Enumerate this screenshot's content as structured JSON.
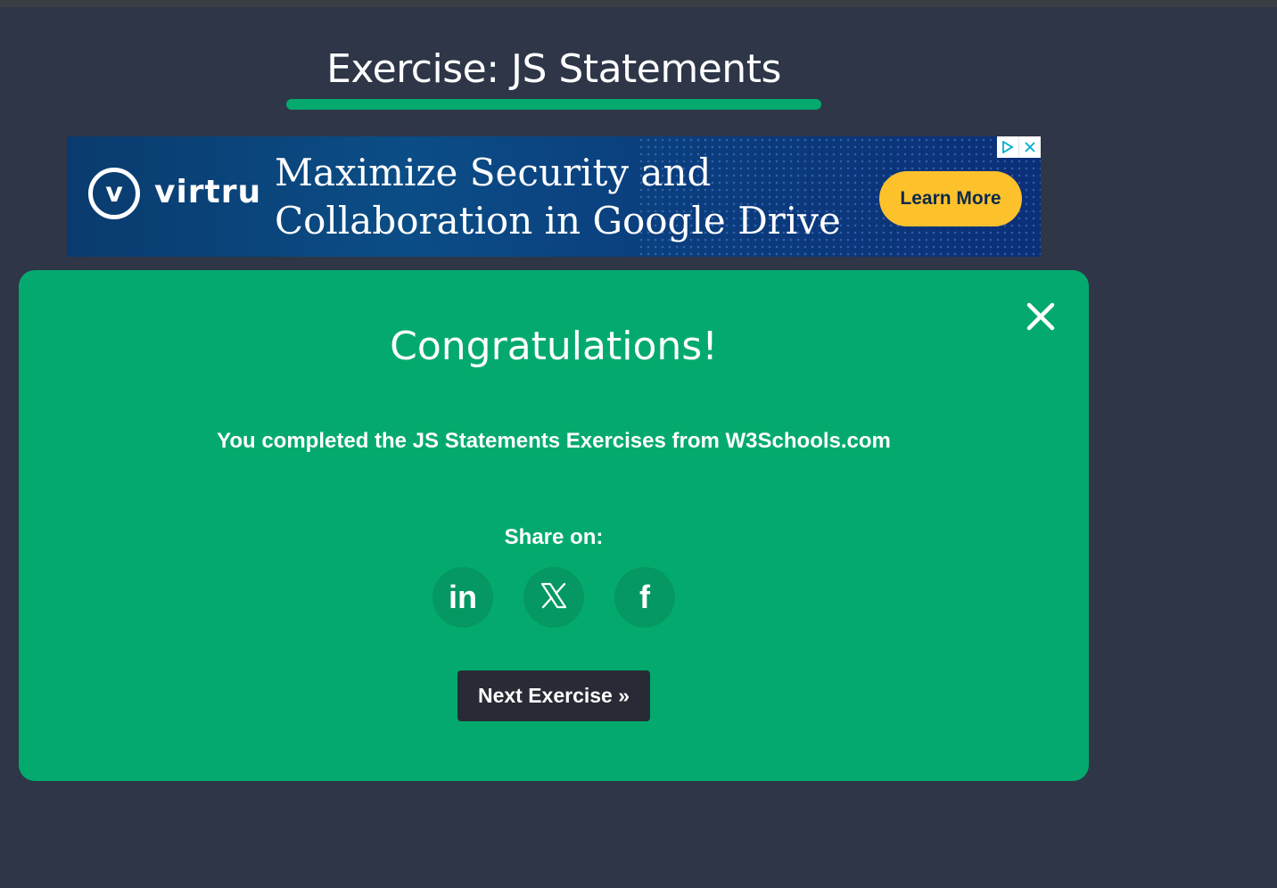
{
  "page": {
    "title": "Exercise: JS Statements",
    "accent_color": "#04aa6d",
    "background_color": "#2e3648"
  },
  "ad": {
    "logo_mark": "v",
    "logo_text": "virtru",
    "headline_line1": "Maximize Security and",
    "headline_line2": "Collaboration in Google Drive",
    "cta_label": "Learn More",
    "cta_color": "#fdc12c",
    "ad_choices_icon": "ad-choices-icon",
    "close_icon": "close-icon"
  },
  "modal": {
    "title": "Congratulations!",
    "message": "You completed the JS Statements Exercises from W3Schools.com",
    "share_label": "Share on:",
    "share_buttons": [
      {
        "network": "LinkedIn",
        "icon": "linkedin-icon",
        "glyph": "in"
      },
      {
        "network": "X",
        "icon": "x-icon",
        "glyph": "X"
      },
      {
        "network": "Facebook",
        "icon": "facebook-icon",
        "glyph": "f"
      }
    ],
    "next_button_label": "Next Exercise »",
    "close_icon": "close-icon",
    "background_color": "#04aa6d",
    "button_color": "#282a35"
  }
}
